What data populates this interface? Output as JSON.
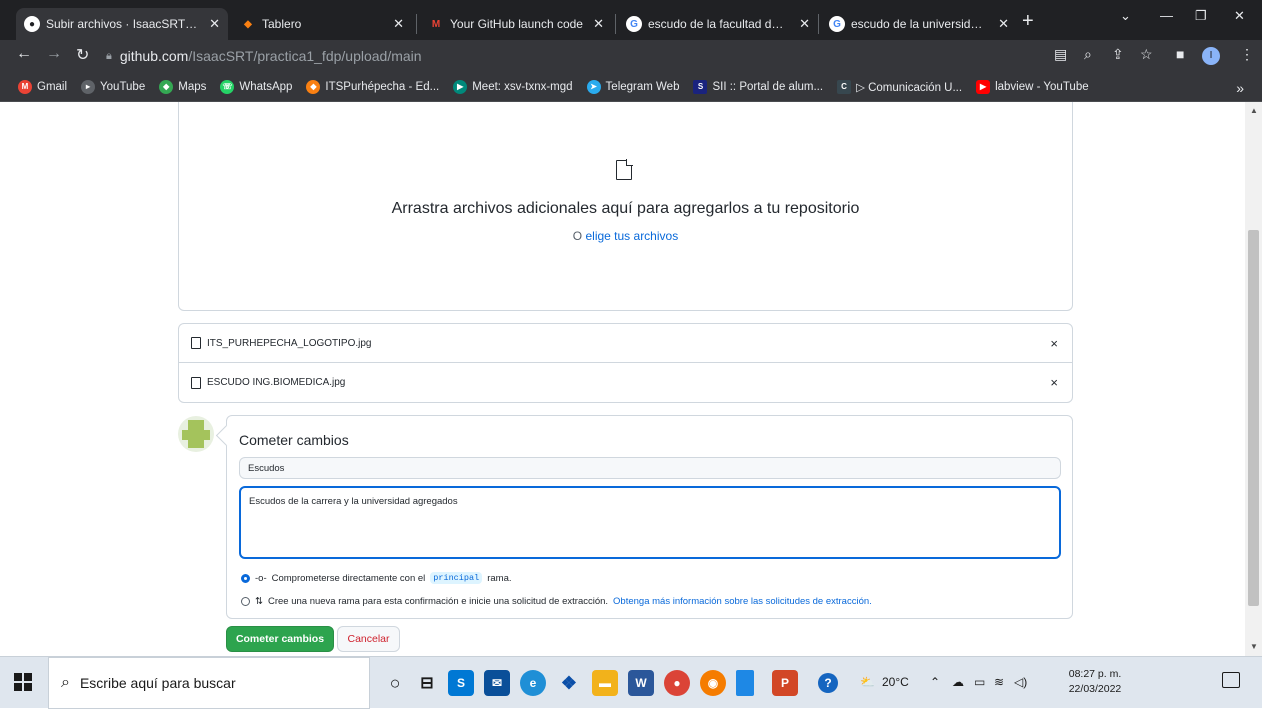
{
  "browser": {
    "tabs": [
      {
        "label": "Subir archivos · IsaacSRT/pra",
        "icon": "github-icon",
        "active": true
      },
      {
        "label": "Tablero",
        "icon": "moodle-icon",
        "active": false
      },
      {
        "label": "Your GitHub launch code",
        "icon": "gmail-icon",
        "active": false
      },
      {
        "label": "escudo de la facultad de ing",
        "icon": "google-icon",
        "active": false
      },
      {
        "label": "escudo de la universidad itsp",
        "icon": "google-icon",
        "active": false
      }
    ],
    "address": {
      "host": "github.com",
      "path": "/IsaacSRT/practica1_fdp/upload/main"
    },
    "bookmarks": [
      {
        "label": "Gmail",
        "icon": "gmail-icon",
        "color": "#ea4335"
      },
      {
        "label": "YouTube",
        "icon": "youtube-icon",
        "color": "#5f6368"
      },
      {
        "label": "Maps",
        "icon": "maps-icon",
        "color": "#34a853"
      },
      {
        "label": "WhatsApp",
        "icon": "whatsapp-icon",
        "color": "#25d366"
      },
      {
        "label": "ITSPurhépecha - Ed...",
        "icon": "moodle-icon",
        "color": "#f98012"
      },
      {
        "label": "Meet: xsv-txnx-mgd",
        "icon": "meet-icon",
        "color": "#00897b"
      },
      {
        "label": "Telegram Web",
        "icon": "telegram-icon",
        "color": "#2aabee"
      },
      {
        "label": "SII :: Portal de alum...",
        "icon": "sii-icon",
        "color": "#1a237e"
      },
      {
        "label": "▷ Comunicación U...",
        "icon": "cai-icon",
        "color": "#37474f"
      },
      {
        "label": "labview - YouTube",
        "icon": "youtube-icon",
        "color": "#ff0000"
      }
    ]
  },
  "upload": {
    "drop_title": "Arrastra archivos adicionales aquí para agregarlos a tu repositorio",
    "drop_sub_prefix": "O",
    "drop_sub_link": "elige tus archivos",
    "files": [
      "ITS_PURHEPECHA_LOGOTIPO.jpg",
      "ESCUDO ING.BIOMEDICA.jpg"
    ],
    "remove_glyph": "×"
  },
  "commit": {
    "title": "Cometer cambios",
    "summary": "Escudos",
    "description": "Escudos de la carrera y la universidad agregados",
    "option1_prefix": "Comprometerse directamente con el",
    "option1_branch": "principal",
    "option1_suffix": "rama.",
    "option2_text": "Cree una nueva rama para esta confirmación e inicie una solicitud de extracción.",
    "option2_link": "Obtenga más información sobre las solicitudes de extracción.",
    "commit_button": "Cometer cambios",
    "cancel_button": "Cancelar"
  },
  "taskbar": {
    "search_placeholder": "Escribe aquí para buscar",
    "weather": "20°C",
    "time": "08:27 p. m.",
    "date": "22/03/2022"
  },
  "colors": {
    "primary_button": "#2da44e",
    "link": "#0969da",
    "danger": "#cf222e"
  }
}
